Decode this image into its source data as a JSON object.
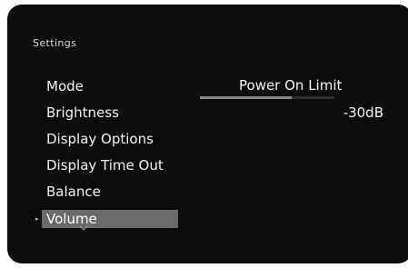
{
  "header": {
    "title": "Settings"
  },
  "menu": {
    "items": [
      {
        "label": "Mode"
      },
      {
        "label": "Brightness"
      },
      {
        "label": "Display Options"
      },
      {
        "label": "Display Time Out"
      },
      {
        "label": "Balance"
      },
      {
        "label": "Volume"
      }
    ],
    "selected_index": 5
  },
  "values": {
    "mode": "Power On Limit",
    "mode_bar_fraction": 0.68,
    "brightness": "-30dB"
  },
  "colors": {
    "background": "#0c0c0e",
    "text": "#f4f4f4",
    "selection": "#6a6a6a"
  },
  "icons": {
    "selection_marker": "right-arrow-icon",
    "more_below": "chevron-down-icon"
  }
}
